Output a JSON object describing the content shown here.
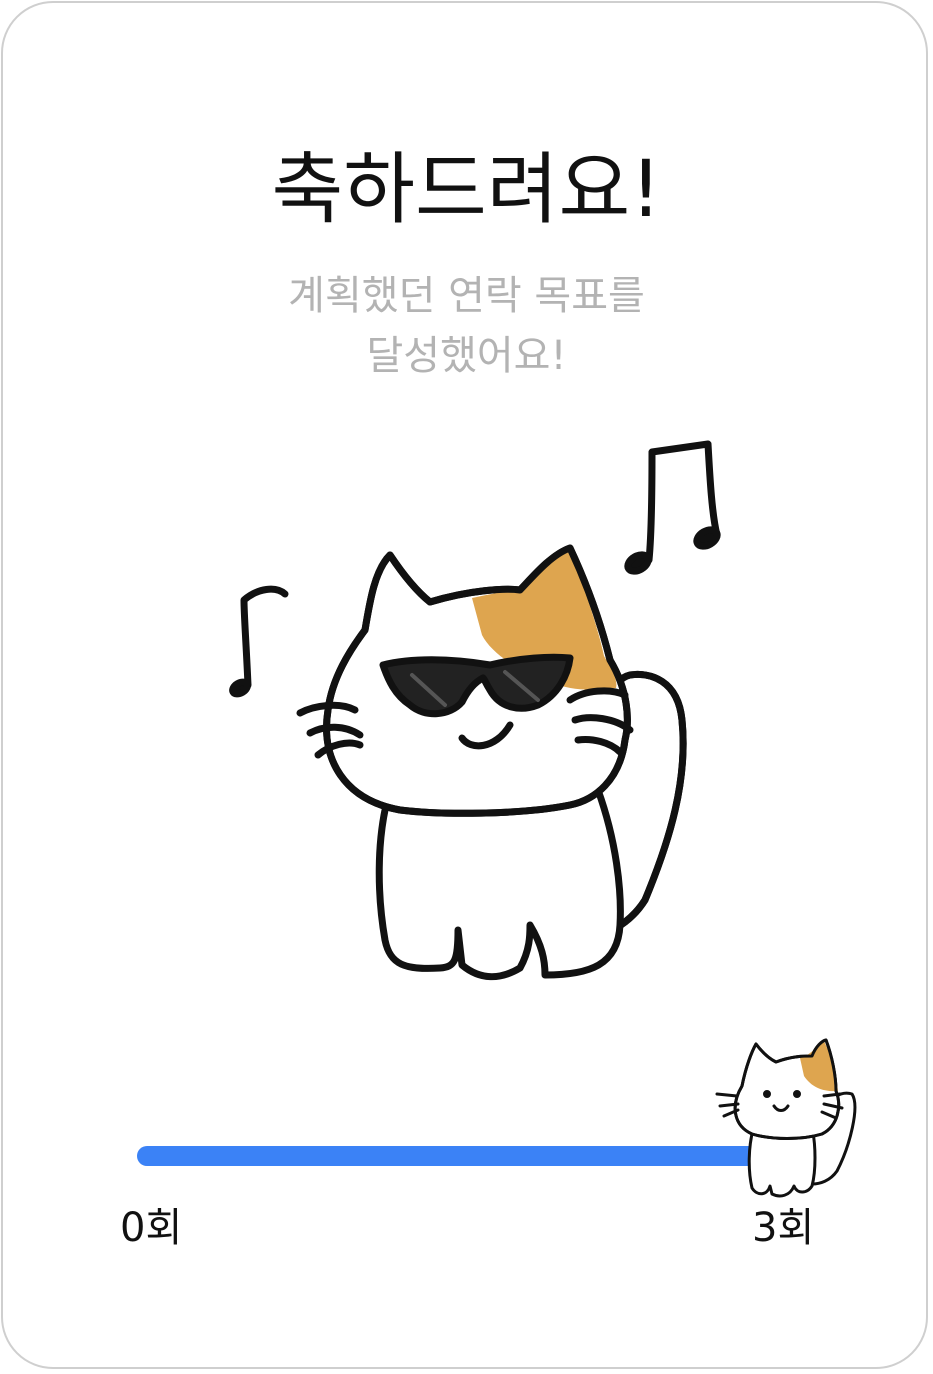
{
  "header": {
    "title": "축하드려요!",
    "subtitle_lines": [
      "계획했던 연락 목표를",
      "달성했어요!"
    ]
  },
  "illustration": {
    "main": "cat-with-sunglasses-and-music-notes",
    "marker": "small-cat-icon"
  },
  "progress": {
    "current": 3,
    "goal": 3,
    "fraction": 1.0,
    "start_label": "0회",
    "end_label": "3회",
    "fill_color": "#3b82f6"
  },
  "colors": {
    "title": "#111111",
    "subtitle": "#b3b3b3",
    "cat_patch": "#dea54f",
    "card_border": "#cfcfcf"
  }
}
